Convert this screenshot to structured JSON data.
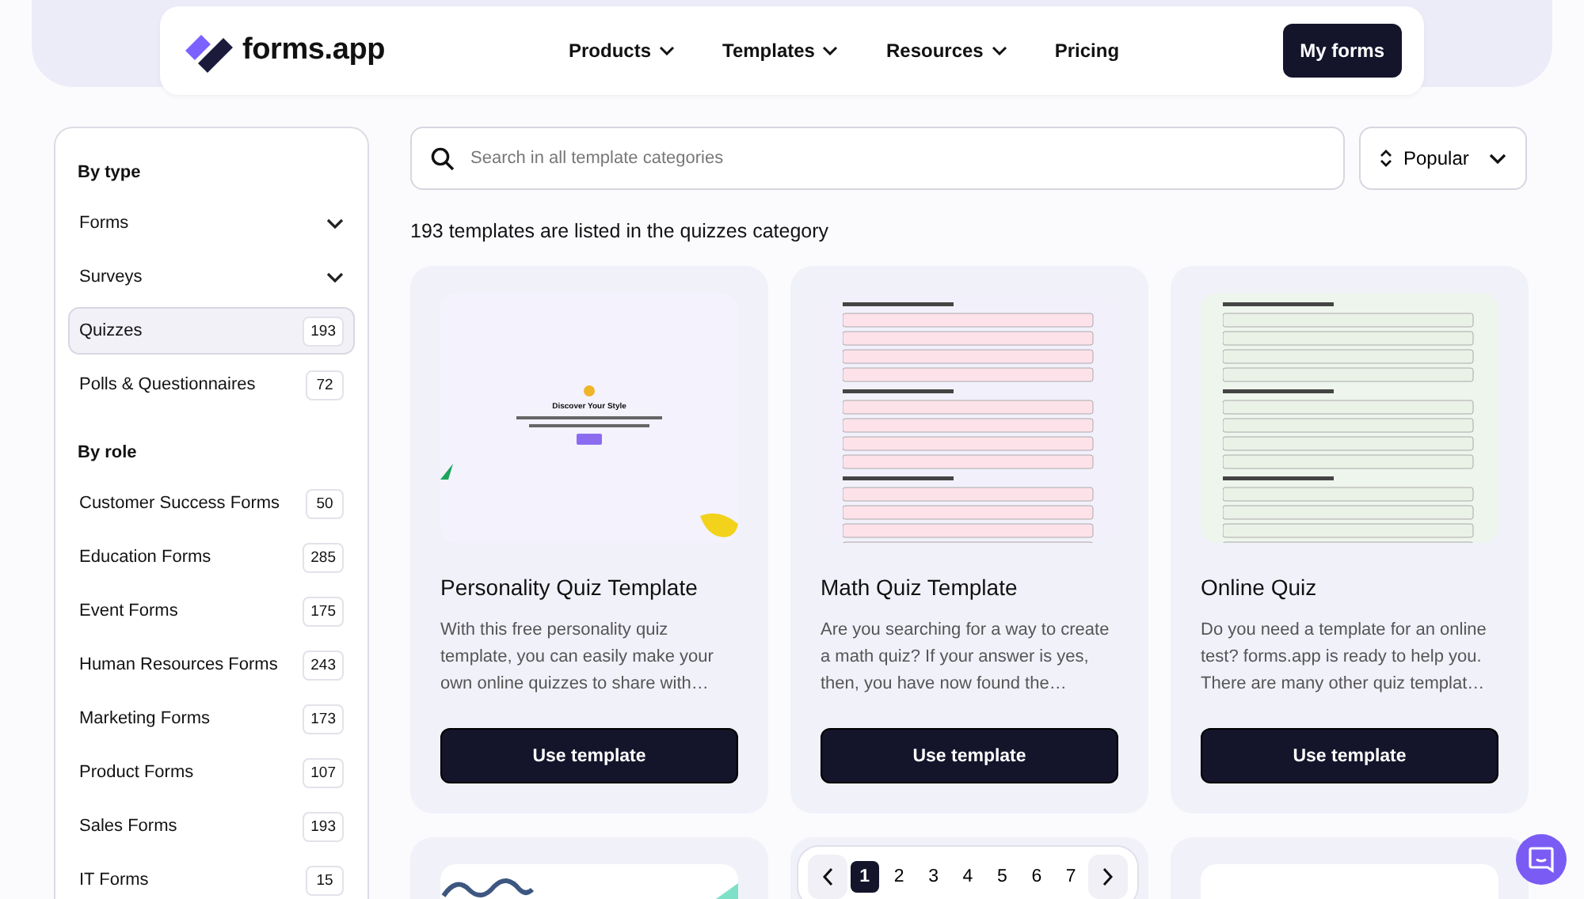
{
  "header": {
    "logo": "forms.app",
    "nav": [
      {
        "label": "Products",
        "dropdown": true
      },
      {
        "label": "Templates",
        "dropdown": true
      },
      {
        "label": "Resources",
        "dropdown": true
      },
      {
        "label": "Pricing",
        "dropdown": false
      }
    ],
    "cta": "My forms"
  },
  "sidebar": {
    "groups": [
      {
        "title": "By type",
        "items": [
          {
            "label": "Forms",
            "kind": "dropdown",
            "expanded": false,
            "selected": false
          },
          {
            "label": "Surveys",
            "kind": "dropdown",
            "expanded": false,
            "selected": false
          },
          {
            "label": "Quizzes",
            "kind": "count",
            "count": "193",
            "selected": true
          },
          {
            "label": "Polls & Questionnaires",
            "kind": "count",
            "count": "72",
            "selected": false
          }
        ]
      },
      {
        "title": "By role",
        "items": [
          {
            "label": "Customer Success Forms",
            "kind": "count",
            "count": "50",
            "selected": false
          },
          {
            "label": "Education Forms",
            "kind": "count",
            "count": "285",
            "selected": false
          },
          {
            "label": "Event Forms",
            "kind": "count",
            "count": "175",
            "selected": false
          },
          {
            "label": "Human Resources Forms",
            "kind": "count",
            "count": "243",
            "selected": false
          },
          {
            "label": "Marketing Forms",
            "kind": "count",
            "count": "173",
            "selected": false
          },
          {
            "label": "Product Forms",
            "kind": "count",
            "count": "107",
            "selected": false
          },
          {
            "label": "Sales Forms",
            "kind": "count",
            "count": "193",
            "selected": false
          },
          {
            "label": "IT Forms",
            "kind": "count",
            "count": "15",
            "selected": false
          }
        ]
      }
    ]
  },
  "search": {
    "placeholder": "Search in all template categories"
  },
  "sort": {
    "value": "Popular"
  },
  "result_count": "193 templates are listed in the quizzes category",
  "templates": [
    {
      "kind": "personality",
      "preview_title": "Discover Your Style",
      "title": "Personality Quiz Template",
      "description": "With this free personality quiz template, you can easily make your own online quizzes to share with…",
      "button": "Use template"
    },
    {
      "kind": "quiz",
      "color": "#fde2ea",
      "title": "Math Quiz Template",
      "description": "Are you searching for a way to create a math quiz? If your answer is yes, then, you have now found the…",
      "button": "Use template"
    },
    {
      "kind": "quiz",
      "color": "#eaf1e6",
      "title": "Online Quiz",
      "description": "Do you need a template for an online test? forms.app is ready to help you. There are many other quiz templat…",
      "button": "Use template"
    },
    {
      "kind": "wave"
    },
    {
      "kind": "covered"
    },
    {
      "kind": "blank"
    }
  ],
  "pagination": {
    "pages": [
      {
        "label": "1",
        "selected": true
      },
      {
        "label": "2",
        "selected": false
      },
      {
        "label": "3",
        "selected": false
      },
      {
        "label": "4",
        "selected": false
      },
      {
        "label": "5",
        "selected": false
      },
      {
        "label": "6",
        "selected": false
      },
      {
        "label": "7",
        "selected": false
      }
    ]
  }
}
